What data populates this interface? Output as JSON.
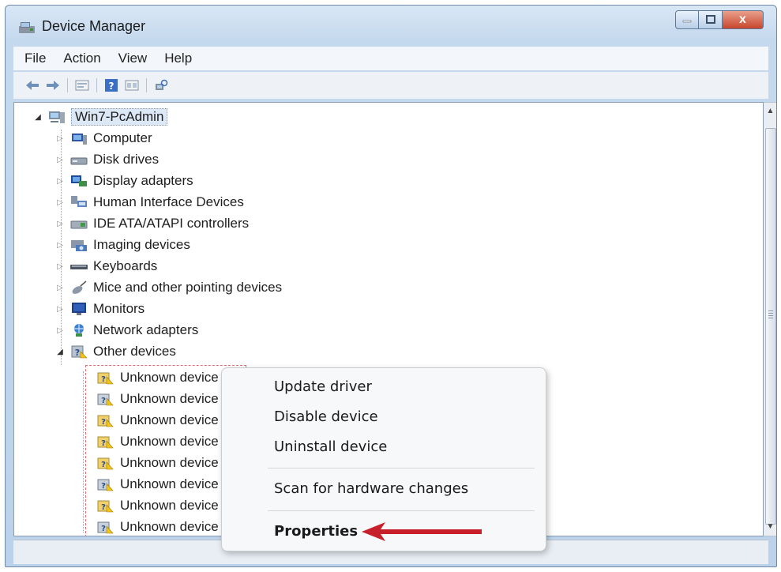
{
  "window": {
    "title": "Device Manager",
    "close_glyph": "x"
  },
  "menubar": {
    "items": [
      "File",
      "Action",
      "View",
      "Help"
    ]
  },
  "toolbar": {
    "buttons": [
      "back-icon",
      "forward-icon",
      "properties-icon",
      "help-icon",
      "view-icon",
      "scan-hardware-icon"
    ]
  },
  "tree": {
    "root": "Win7-PcAdmin",
    "categories": [
      "Computer",
      "Disk drives",
      "Display adapters",
      "Human Interface Devices",
      "IDE ATA/ATAPI controllers",
      "Imaging devices",
      "Keyboards",
      "Mice and other pointing devices",
      "Monitors",
      "Network adapters",
      "Other devices"
    ],
    "other_devices_children": [
      "Unknown device",
      "Unknown device",
      "Unknown device",
      "Unknown device",
      "Unknown device",
      "Unknown device",
      "Unknown device",
      "Unknown device"
    ]
  },
  "context_menu": {
    "items": [
      "Update driver",
      "Disable device",
      "Uninstall device"
    ],
    "scan": "Scan for hardware changes",
    "properties": "Properties"
  },
  "colors": {
    "annotation_red": "#c8202a",
    "selection": "#dce8f6",
    "title_close": "#c8452c"
  }
}
